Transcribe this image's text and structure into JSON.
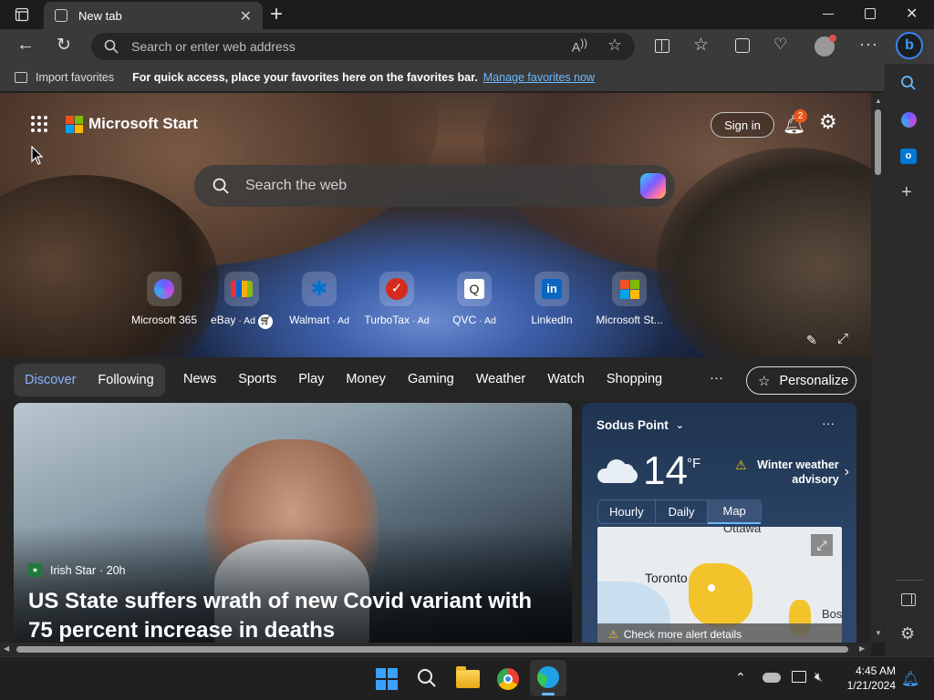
{
  "browser": {
    "tab_title": "New tab",
    "address_placeholder": "Search or enter web address"
  },
  "favorites_bar": {
    "import_label": "Import favorites",
    "hint": "For quick access, place your favorites here on the favorites bar.",
    "manage_link": "Manage favorites now"
  },
  "header": {
    "brand": "Microsoft Start",
    "sign_in": "Sign in",
    "notification_count": "2"
  },
  "search": {
    "placeholder": "Search the web"
  },
  "quick_links": [
    {
      "label": "Microsoft 365",
      "ad": ""
    },
    {
      "label": "eBay",
      "ad": "· Ad"
    },
    {
      "label": "Walmart",
      "ad": "· Ad"
    },
    {
      "label": "TurboTax",
      "ad": "· Ad"
    },
    {
      "label": "QVC",
      "ad": "· Ad"
    },
    {
      "label": "LinkedIn",
      "ad": ""
    },
    {
      "label": "Microsoft St...",
      "ad": ""
    }
  ],
  "feed_nav": {
    "discover": "Discover",
    "following": "Following",
    "tabs": [
      "News",
      "Sports",
      "Play",
      "Money",
      "Gaming",
      "Weather",
      "Watch",
      "Shopping"
    ],
    "more": "···",
    "personalize": "Personalize"
  },
  "news_card": {
    "source": "Irish Star",
    "age": "· 20h",
    "headline": "US State suffers wrath of new Covid variant with 75 percent increase in deaths"
  },
  "weather": {
    "location": "Sodus Point",
    "temperature": "14",
    "unit": "°F",
    "alert": "Winter weather advisory",
    "tabs": [
      "Hourly",
      "Daily",
      "Map"
    ],
    "active_tab": "Map",
    "map_labels": {
      "city1": "Ottawa",
      "city2": "Toronto",
      "city3": "Bos"
    },
    "more_alerts": "Check more alert details"
  },
  "taskbar": {
    "time": "4:45 AM",
    "date": "1/21/2024"
  },
  "colors": {
    "accent_link": "#6cb8ff",
    "discover_blue": "#8ab4ff",
    "notification_badge": "#e8571e"
  }
}
